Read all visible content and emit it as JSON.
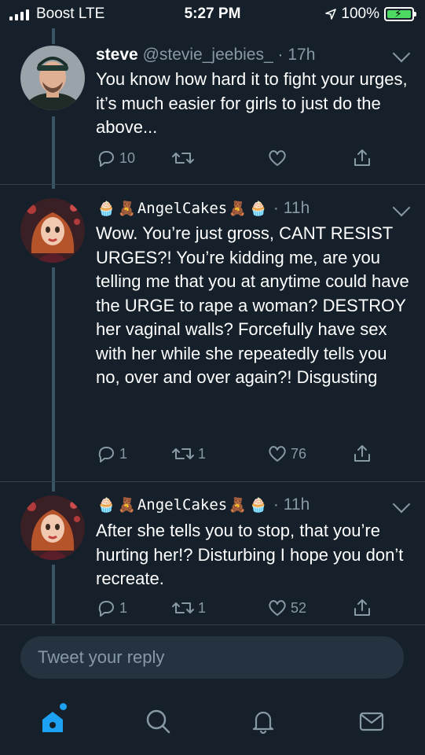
{
  "status_bar": {
    "carrier": "Boost  LTE",
    "time": "5:27 PM",
    "battery": "100%"
  },
  "tweets": [
    {
      "name": "steve",
      "handle": "@stevie_jeebies_",
      "sep": "·",
      "age": "17h",
      "text": "You know how hard it to fight your urges, it’s much easier for girls to just do the above...",
      "replies": "10",
      "retweets": "",
      "likes": ""
    },
    {
      "name": "AngelCakes",
      "handle": "",
      "sep": "·",
      "age": "11h",
      "text": "Wow. You’re just gross, CANT RESIST URGES?! You’re kidding me, are you telling me that you at anytime could have the URGE to rape a woman? DESTROY her vaginal walls? Forcefully have sex with her while she repeatedly tells you no, over and over again?! Disgusting",
      "replies": "1",
      "retweets": "1",
      "likes": "76"
    },
    {
      "name": "AngelCakes",
      "handle": "",
      "sep": "·",
      "age": "11h",
      "text": "After she tells you to stop, that you’re hurting her!? Disturbing I hope you don’t recreate.",
      "replies": "1",
      "retweets": "1",
      "likes": "52"
    }
  ],
  "name_emoji": {
    "cupcake": "🧁",
    "bear": "🧸"
  },
  "reply_box": {
    "placeholder": "Tweet your reply"
  },
  "tabs": [
    "home-icon",
    "search-icon",
    "notifications-icon",
    "messages-icon"
  ],
  "colors": {
    "background": "#15202b",
    "secondary_text": "#8899a6",
    "accent": "#1da1f2",
    "battery": "#4cd964"
  }
}
